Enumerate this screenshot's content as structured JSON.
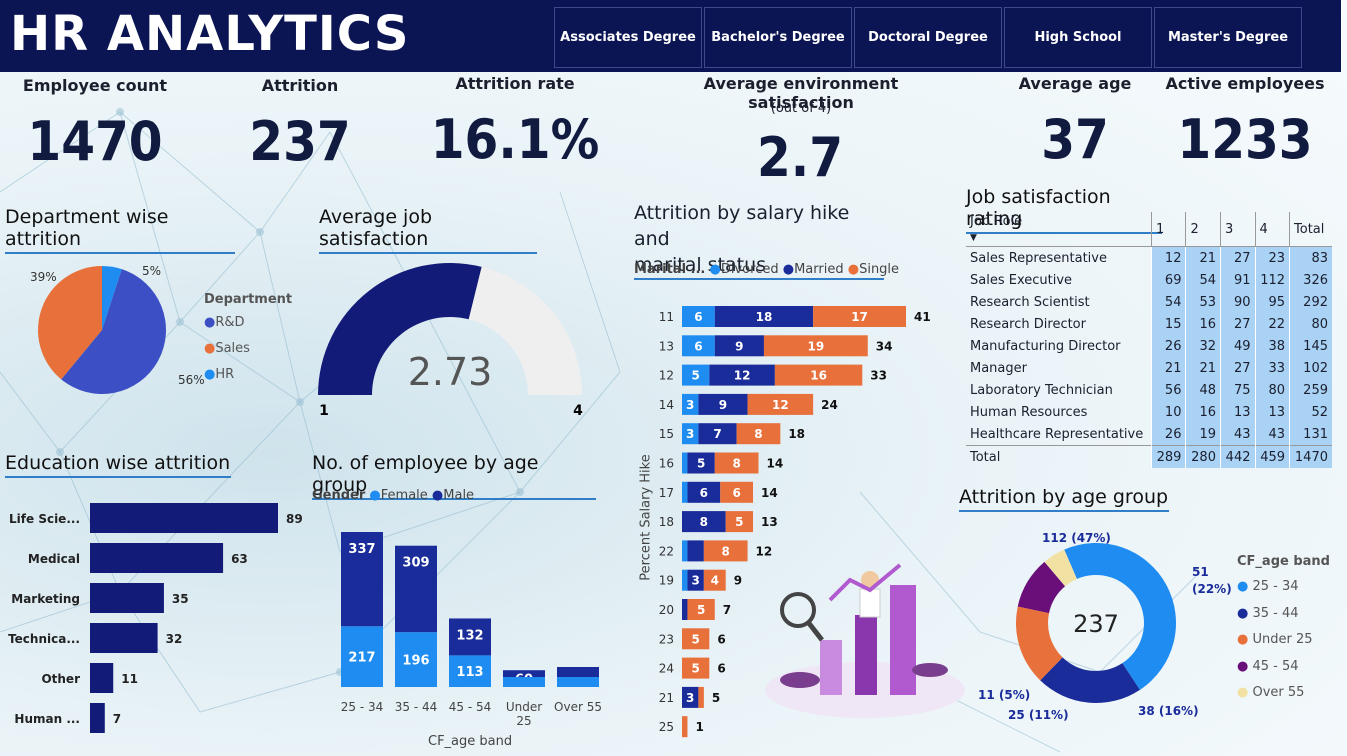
{
  "header": {
    "title": "HR ANALYTICS",
    "education_slicer": [
      "Associates Degree",
      "Bachelor's Degree",
      "Doctoral Degree",
      "High School",
      "Master's Degree"
    ]
  },
  "kpis": {
    "employee_count": {
      "label": "Employee count",
      "value": "1470"
    },
    "attrition": {
      "label": "Attrition",
      "value": "237"
    },
    "attrition_rate": {
      "label": "Attrition rate",
      "value": "16.1%"
    },
    "env_satisfaction": {
      "label": "Average environment satisfaction",
      "sub": "(out of 4)",
      "value": "2.7"
    },
    "average_age": {
      "label": "Average age",
      "value": "37"
    },
    "active_employees": {
      "label": "Active employees",
      "value": "1233"
    }
  },
  "department_attrition": {
    "title": "Department wise attrition",
    "legend_title": "Department",
    "colors": {
      "R&D": "#3d4fc4",
      "Sales": "#e8703a",
      "HR": "#1e8cf0"
    }
  },
  "job_satisfaction_gauge": {
    "title": "Average job satisfaction",
    "value": "2.73",
    "min": "1",
    "max": "4",
    "fraction": 0.577
  },
  "education_attrition": {
    "title": "Education wise attrition"
  },
  "age_group_employees": {
    "title": "No. of employee by age group",
    "legend_title": "Gender",
    "female": "Female",
    "male": "Male",
    "xaxis_title": "CF_age band"
  },
  "salary_hike": {
    "title_line1": "Attrition by salary hike and",
    "title_line2": "marital status",
    "legend_title": "Marital ...",
    "legend": [
      "Divorced",
      "Married",
      "Single"
    ],
    "yaxis_title": "Percent Salary Hike"
  },
  "job_satisfaction_table": {
    "title": "Job satisfaction rating",
    "headers": [
      "Job Role",
      "1",
      "2",
      "3",
      "4",
      "Total"
    ],
    "rows": [
      [
        "Sales Representative",
        "12",
        "21",
        "27",
        "23",
        "83"
      ],
      [
        "Sales Executive",
        "69",
        "54",
        "91",
        "112",
        "326"
      ],
      [
        "Research Scientist",
        "54",
        "53",
        "90",
        "95",
        "292"
      ],
      [
        "Research Director",
        "15",
        "16",
        "27",
        "22",
        "80"
      ],
      [
        "Manufacturing Director",
        "26",
        "32",
        "49",
        "38",
        "145"
      ],
      [
        "Manager",
        "21",
        "21",
        "27",
        "33",
        "102"
      ],
      [
        "Laboratory Technician",
        "56",
        "48",
        "75",
        "80",
        "259"
      ],
      [
        "Human Resources",
        "10",
        "16",
        "13",
        "13",
        "52"
      ],
      [
        "Healthcare Representative",
        "26",
        "19",
        "43",
        "43",
        "131"
      ]
    ],
    "total": [
      "Total",
      "289",
      "280",
      "442",
      "459",
      "1470"
    ]
  },
  "attrition_age": {
    "title": "Attrition by age group",
    "center": "237",
    "legend_title": "CF_age band"
  },
  "chart_data": [
    {
      "type": "pie",
      "title": "Department wise attrition",
      "legend_title": "Department",
      "slices": [
        {
          "name": "R&D",
          "value": 56,
          "label": "56%"
        },
        {
          "name": "Sales",
          "value": 39,
          "label": "39%"
        },
        {
          "name": "HR",
          "value": 5,
          "label": "5%"
        }
      ]
    },
    {
      "type": "bar",
      "title": "Education wise attrition",
      "orientation": "horizontal",
      "categories": [
        "Life Scie...",
        "Medical",
        "Marketing",
        "Technica...",
        "Other",
        "Human ..."
      ],
      "values": [
        89,
        63,
        35,
        32,
        11,
        7
      ]
    },
    {
      "type": "bar",
      "title": "No. of employee by age group",
      "stacked": true,
      "xlabel": "CF_age band",
      "categories": [
        "25 - 34",
        "35 - 44",
        "45 - 54",
        "Under 25",
        "Over 55"
      ],
      "series": [
        {
          "name": "Female",
          "values": [
            217,
            196,
            113,
            null,
            null
          ]
        },
        {
          "name": "Male",
          "values": [
            337,
            309,
            132,
            60,
            null
          ]
        }
      ]
    },
    {
      "type": "bar",
      "title": "Attrition by salary hike and marital status",
      "stacked": true,
      "orientation": "horizontal",
      "ylabel": "Percent Salary Hike",
      "categories": [
        "11",
        "13",
        "12",
        "14",
        "15",
        "16",
        "17",
        "18",
        "22",
        "19",
        "20",
        "23",
        "24",
        "21",
        "25"
      ],
      "series": [
        {
          "name": "Divorced",
          "values": [
            6,
            6,
            5,
            3,
            3,
            1,
            1,
            0,
            1,
            1,
            0,
            0,
            0,
            0,
            0
          ]
        },
        {
          "name": "Married",
          "values": [
            18,
            9,
            12,
            9,
            7,
            5,
            6,
            8,
            3,
            3,
            1,
            0,
            0,
            3,
            0
          ]
        },
        {
          "name": "Single",
          "values": [
            17,
            19,
            16,
            12,
            8,
            8,
            6,
            5,
            8,
            4,
            5,
            5,
            5,
            1,
            1
          ]
        }
      ],
      "totals": [
        41,
        34,
        33,
        24,
        18,
        14,
        14,
        13,
        12,
        9,
        7,
        6,
        6,
        5,
        1
      ],
      "labels": [
        [
          "6",
          "18",
          "17"
        ],
        [
          "6",
          "9",
          "19"
        ],
        [
          "5",
          "12",
          "16"
        ],
        [
          "3",
          "9",
          "12"
        ],
        [
          "3",
          "7",
          "8"
        ],
        [
          "",
          "5",
          "8"
        ],
        [
          "",
          "6",
          "6"
        ],
        [
          "",
          "8",
          "5"
        ],
        [
          "",
          "",
          "8"
        ],
        [
          "",
          "3",
          "4"
        ],
        [
          "",
          "",
          "5"
        ],
        [
          "",
          "",
          "5"
        ],
        [
          "",
          "",
          "5"
        ],
        [
          "",
          "3",
          ""
        ],
        [
          "",
          "",
          ""
        ]
      ]
    },
    {
      "type": "pie",
      "title": "Attrition by age group",
      "donut": true,
      "legend_title": "CF_age band",
      "slices": [
        {
          "name": "25 - 34",
          "value": 112,
          "label": "112 (47%)",
          "color": "#1e8cf0"
        },
        {
          "name": "35 - 44",
          "value": 51,
          "label": "51 (22%)",
          "color": "#1a2c9a"
        },
        {
          "name": "Under 25",
          "value": 38,
          "label": "38 (16%)",
          "color": "#e8703a"
        },
        {
          "name": "45 - 54",
          "value": 25,
          "label": "25 (11%)",
          "color": "#6a0f7a"
        },
        {
          "name": "Over 55",
          "value": 11,
          "label": "11 (5%)",
          "color": "#f1e2a4"
        }
      ]
    }
  ]
}
